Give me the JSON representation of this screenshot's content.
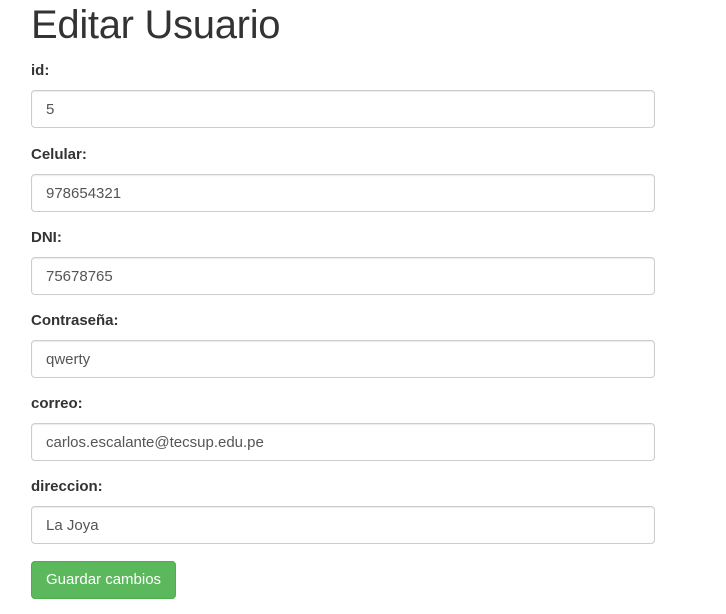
{
  "page": {
    "title": "Editar Usuario"
  },
  "form": {
    "fields": [
      {
        "label": "id:",
        "value": "5"
      },
      {
        "label": "Celular:",
        "value": "978654321"
      },
      {
        "label": "DNI:",
        "value": "75678765"
      },
      {
        "label": "Contraseña:",
        "value": "qwerty"
      },
      {
        "label": "correo:",
        "value": "carlos.escalante@tecsup.edu.pe"
      },
      {
        "label": "direccion:",
        "value": "La Joya"
      }
    ],
    "submit_label": "Guardar cambios"
  },
  "colors": {
    "button_bg": "#5cb85c",
    "button_border": "#4cae4c",
    "input_border": "#cccccc",
    "text": "#333333"
  }
}
